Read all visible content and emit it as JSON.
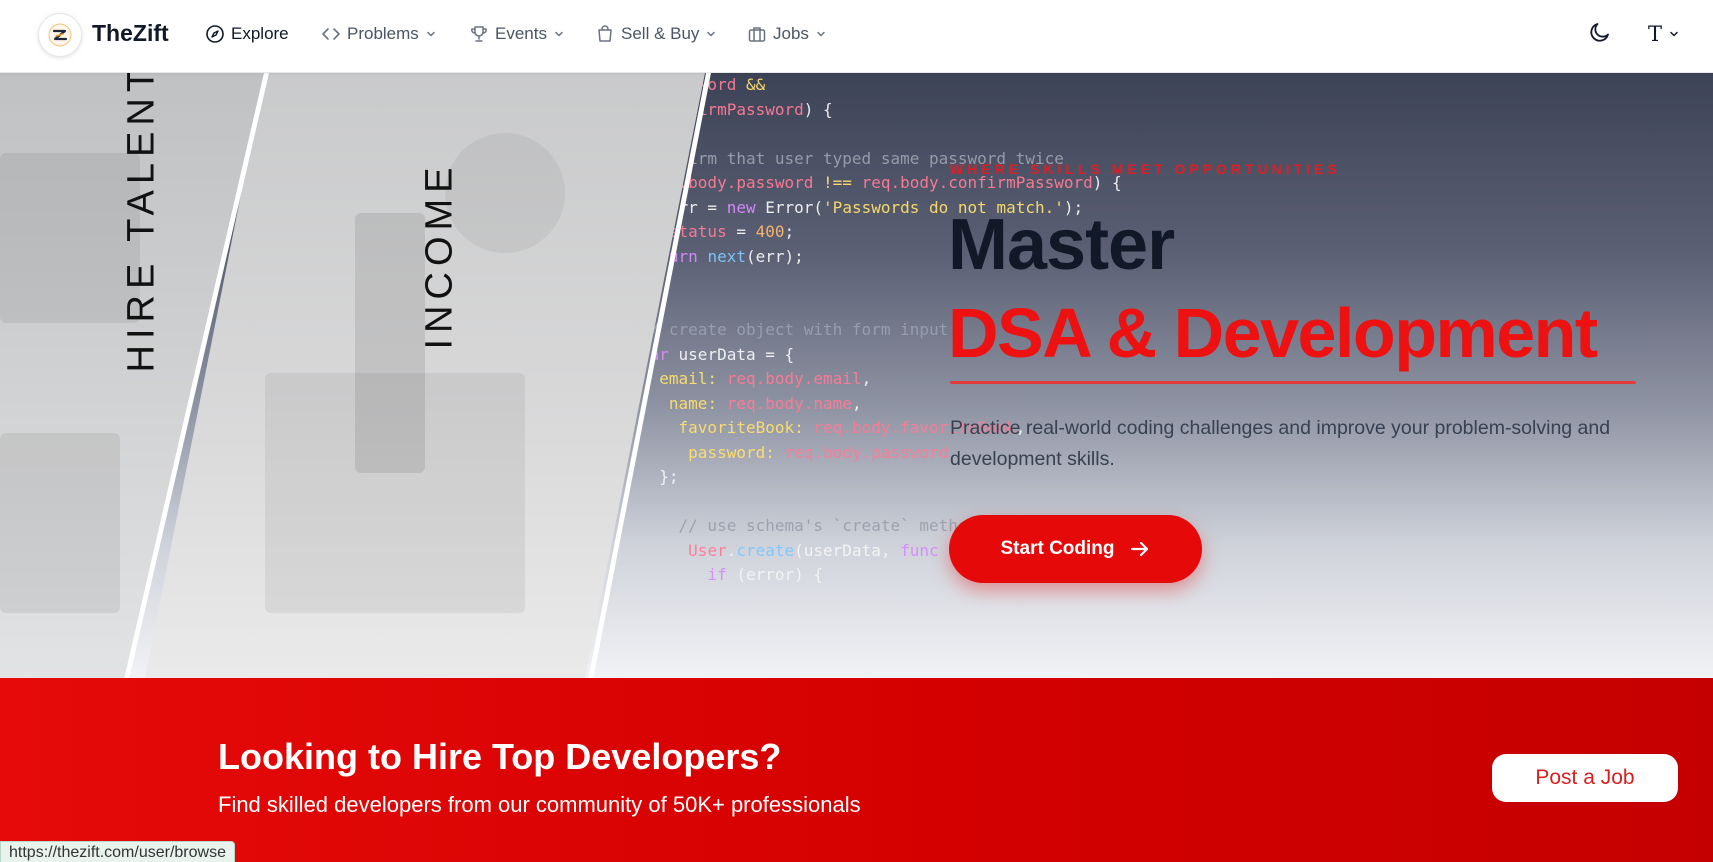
{
  "nav": {
    "brand": "TheZift",
    "items": [
      {
        "label": "Explore",
        "icon": "compass-icon",
        "dropdown": false
      },
      {
        "label": "Problems",
        "icon": "code-icon",
        "dropdown": true
      },
      {
        "label": "Events",
        "icon": "trophy-icon",
        "dropdown": true
      },
      {
        "label": "Sell & Buy",
        "icon": "shopping-bag-icon",
        "dropdown": true
      },
      {
        "label": "Jobs",
        "icon": "briefcase-icon",
        "dropdown": true
      }
    ],
    "theme_icon": "moon-icon",
    "font_icon_label": "T"
  },
  "hero": {
    "vertical_left": "HIRE TALENT",
    "vertical_right": "INCOME",
    "tagline": "WHERE SKILLS MEET OPPORTUNITIES",
    "title_line1": "Master",
    "title_line2": "DSA & Development",
    "description": "Practice real-world coding challenges and improve your problem-solving and development skills.",
    "cta_label": "Start Coding"
  },
  "band": {
    "title": "Looking to Hire Top Developers?",
    "subtitle": "Find skilled developers from our community of 50K+ professionals",
    "button_label": "Post a Job"
  },
  "status_url": "https://thezift.com/user/browse",
  "colors": {
    "accent": "#e50909",
    "band": "#d40000",
    "text_dark": "#111827"
  }
}
